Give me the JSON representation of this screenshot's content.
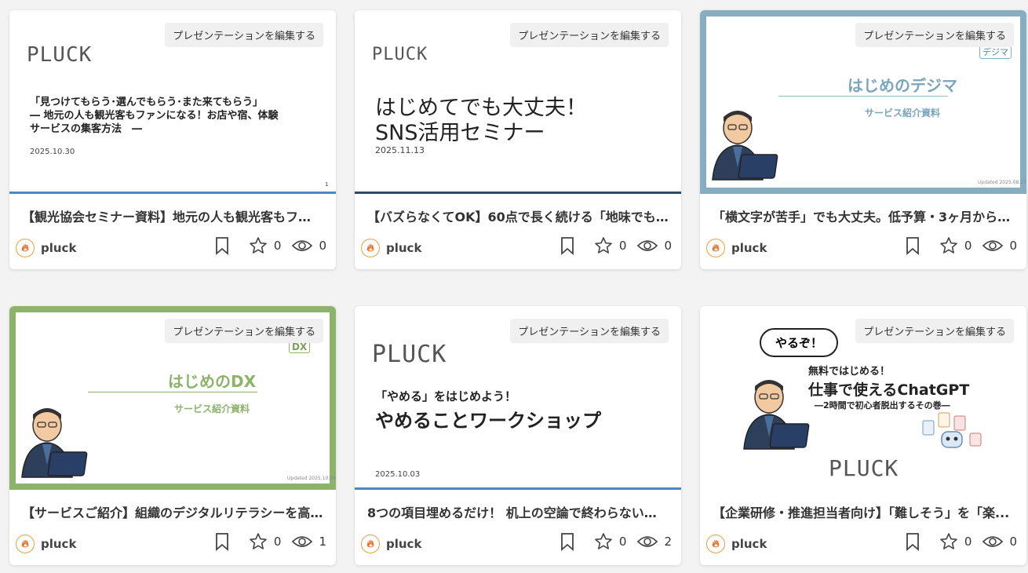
{
  "edit_label": "プレゼンテーションを編集する",
  "author": "pluck",
  "cards": [
    {
      "caption": "【観光協会セミナー資料】地元の人も観光客もファ...",
      "likes": "0",
      "views": "0",
      "slide": {
        "logo": "PLUCK",
        "line1": "「見つけてもらう･選んでもらう･また来てもらう」",
        "line2": "― 地元の人も観光客もファンになる！お店や宿、体験",
        "line3": "サービスの集客方法　―",
        "date": "2025.10.30",
        "page": "1"
      }
    },
    {
      "caption": "【バズらなくてOK】60点で長く続ける「地味でも...",
      "likes": "0",
      "views": "0",
      "slide": {
        "logo": "PLUCK",
        "line1": "はじめてでも大丈夫！",
        "line2": "SNS活用セミナー",
        "date": "2025.11.13"
      }
    },
    {
      "caption": "「横文字が苦手」でも大丈夫。低予算・3ヶ月からS...",
      "likes": "0",
      "views": "0",
      "slide": {
        "badge": "デジマ",
        "title": "はじめのデジマ",
        "subtitle": "サービス紹介資料",
        "updated": "Updated 2025.08.17",
        "frame_color": "#86aec0"
      }
    },
    {
      "caption": "【サービスご紹介】組織のデジタルリテラシーを高...",
      "likes": "0",
      "views": "1",
      "slide": {
        "badge": "DX",
        "title": "はじめのDX",
        "subtitle": "サービス紹介資料",
        "updated": "Updated 2025.10.09",
        "frame_color": "#8db36b"
      }
    },
    {
      "caption": "8つの項目埋めるだけ！ 机上の空論で終わらない「...",
      "likes": "0",
      "views": "2",
      "slide": {
        "logo": "PLUCK",
        "line1": "「やめる」をはじめよう！",
        "line2": "やめることワークショップ",
        "date": "2025.10.03"
      }
    },
    {
      "caption": "【企業研修・推進担当者向け】「難しそう」を「楽...",
      "likes": "0",
      "views": "0",
      "slide": {
        "bubble": "やるぞ！",
        "line1": "無料ではじめる！",
        "line2": "仕事で使えるChatGPT",
        "line3": "―2時間で初心者脱出するその巻―",
        "logo": "PLUCK"
      }
    }
  ]
}
